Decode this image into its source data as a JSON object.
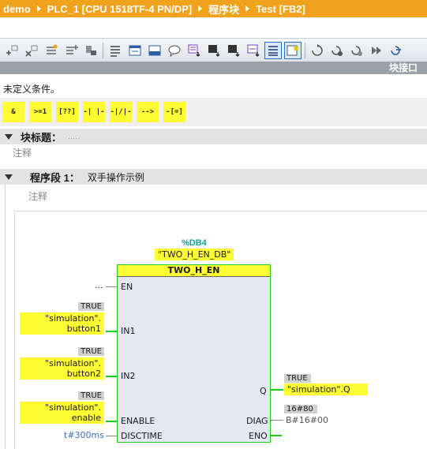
{
  "breadcrumb": [
    "demo",
    "PLC_1 [CPU 1518TF-4 PN/DP]",
    "程序块",
    "Test [FB2]"
  ],
  "toolbar": {
    "icons": [
      "insert-network-icon",
      "delete-network-icon",
      "insert-row-icon",
      "add-row-icon",
      "download-icon",
      "absolute-operands-icon",
      "favorites-icon",
      "network-overview-icon",
      "comments-icon",
      "open-all-networks-icon",
      "close-all-networks-icon",
      "monitoring-icon",
      "compare-icon",
      "list-icon",
      "favorites-star-icon",
      "go-to-icon",
      "go-to-error-icon",
      "next-icon",
      "step-icon",
      "call-icon"
    ]
  },
  "interface_bar": "块接口",
  "undefined_conditions": "未定义条件。",
  "favorites": [
    "&",
    ">=1",
    "[??]",
    "-| |-",
    "-|/|-",
    "-->",
    "-[=]"
  ],
  "block_title": {
    "label": "块标题：",
    "placeholder": "....."
  },
  "block_comment": "注释",
  "network": {
    "label": "程序段 1：",
    "name": "双手操作示例",
    "comment": "注释"
  },
  "fb": {
    "db_ref": "%DB4",
    "db_name": "\"TWO_H_EN_DB\"",
    "type": "TWO_H_EN",
    "inputs": [
      {
        "pin": "EN",
        "value_tag": "",
        "var": "..."
      },
      {
        "pin": "IN1",
        "value_tag": "TRUE",
        "var_line1": "\"simulation\".",
        "var_line2": "button1"
      },
      {
        "pin": "IN2",
        "value_tag": "TRUE",
        "var_line1": "\"simulation\".",
        "var_line2": "button2"
      },
      {
        "pin": "ENABLE",
        "value_tag": "TRUE",
        "var_line1": "\"simulation\".",
        "var_line2": "enable"
      },
      {
        "pin": "DISCTIME",
        "value": "t#300ms"
      }
    ],
    "outputs": [
      {
        "pin": "Q",
        "value_tag": "TRUE",
        "var": "\"simulation\".Q"
      },
      {
        "pin": "DIAG",
        "value_tag": "16#80",
        "var": "B#16#00"
      },
      {
        "pin": "ENO"
      }
    ]
  },
  "colors": {
    "breadcrumb": "#f0a21c",
    "highlight": "#ffff33",
    "wire": "#19d019",
    "db_ref": "#1a9e9e",
    "time_const": "#3a6fc0"
  }
}
